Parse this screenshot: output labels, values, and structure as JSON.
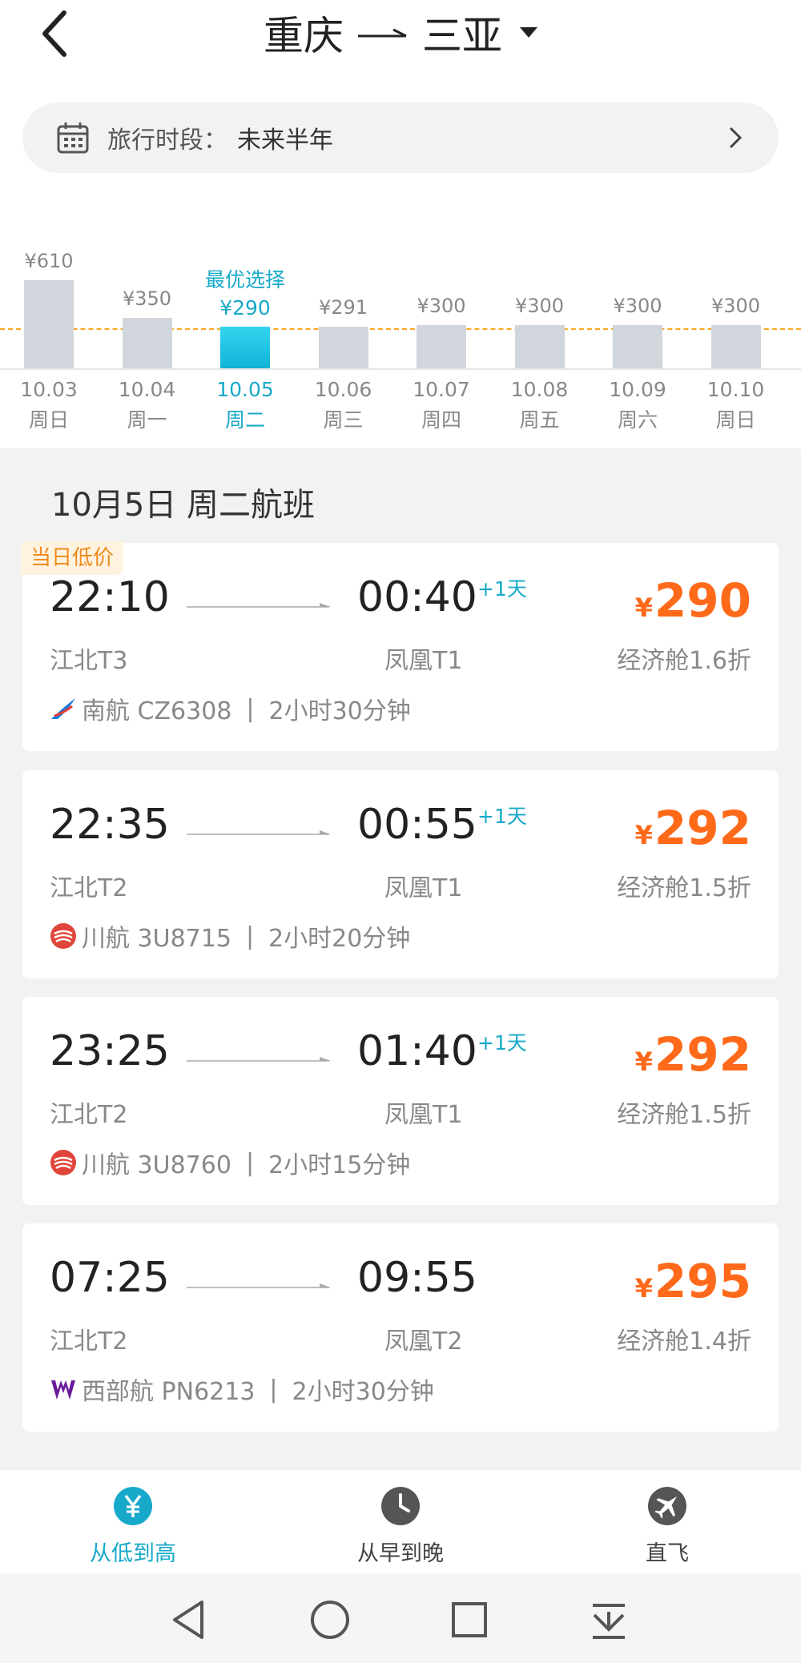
{
  "header": {
    "origin": "重庆",
    "destination": "三亚"
  },
  "period": {
    "label": "旅行时段：",
    "value": "未来半年"
  },
  "calendar": {
    "best_label": "最优选择",
    "days": [
      {
        "date": "10.03",
        "weekday": "周日",
        "price": "¥610",
        "value": 610,
        "selected": false
      },
      {
        "date": "10.04",
        "weekday": "周一",
        "price": "¥350",
        "value": 350,
        "selected": false
      },
      {
        "date": "10.05",
        "weekday": "周二",
        "price": "¥290",
        "value": 290,
        "selected": true
      },
      {
        "date": "10.06",
        "weekday": "周三",
        "price": "¥291",
        "value": 291,
        "selected": false
      },
      {
        "date": "10.07",
        "weekday": "周四",
        "price": "¥300",
        "value": 300,
        "selected": false
      },
      {
        "date": "10.08",
        "weekday": "周五",
        "price": "¥300",
        "value": 300,
        "selected": false
      },
      {
        "date": "10.09",
        "weekday": "周六",
        "price": "¥300",
        "value": 300,
        "selected": false
      },
      {
        "date": "10.10",
        "weekday": "周日",
        "price": "¥300",
        "value": 300,
        "selected": false
      }
    ]
  },
  "section_title": "10月5日 周二航班",
  "flights": [
    {
      "badge": "当日低价",
      "dep_time": "22:10",
      "arr_time": "00:40",
      "plus": "+1天",
      "dep_airport": "江北T3",
      "arr_airport": "凤凰T1",
      "currency": "¥",
      "price": "290",
      "cabin": "经济舱1.6折",
      "airline": "南航 CZ6308",
      "duration": "2小时30分钟",
      "logo": "china-southern-logo-icon"
    },
    {
      "badge": "",
      "dep_time": "22:35",
      "arr_time": "00:55",
      "plus": "+1天",
      "dep_airport": "江北T2",
      "arr_airport": "凤凰T1",
      "currency": "¥",
      "price": "292",
      "cabin": "经济舱1.5折",
      "airline": "川航 3U8715",
      "duration": "2小时20分钟",
      "logo": "sichuan-airlines-logo-icon"
    },
    {
      "badge": "",
      "dep_time": "23:25",
      "arr_time": "01:40",
      "plus": "+1天",
      "dep_airport": "江北T2",
      "arr_airport": "凤凰T1",
      "currency": "¥",
      "price": "292",
      "cabin": "经济舱1.5折",
      "airline": "川航 3U8760",
      "duration": "2小时15分钟",
      "logo": "sichuan-airlines-logo-icon"
    },
    {
      "badge": "",
      "dep_time": "07:25",
      "arr_time": "09:55",
      "plus": "",
      "dep_airport": "江北T2",
      "arr_airport": "凤凰T2",
      "currency": "¥",
      "price": "295",
      "cabin": "经济舱1.4折",
      "airline": "西部航 PN6213",
      "duration": "2小时30分钟",
      "logo": "west-air-logo-icon"
    }
  ],
  "tabs": [
    {
      "label": "从低到高",
      "icon": "yen-icon",
      "active": true
    },
    {
      "label": "从早到晚",
      "icon": "clock-icon",
      "active": false
    },
    {
      "label": "直飞",
      "icon": "plane-icon",
      "active": false
    }
  ],
  "colors": {
    "accent": "#17a9c9",
    "price": "#ff6a1a",
    "badge": "#f08a1c",
    "dash": "#f5a623"
  }
}
